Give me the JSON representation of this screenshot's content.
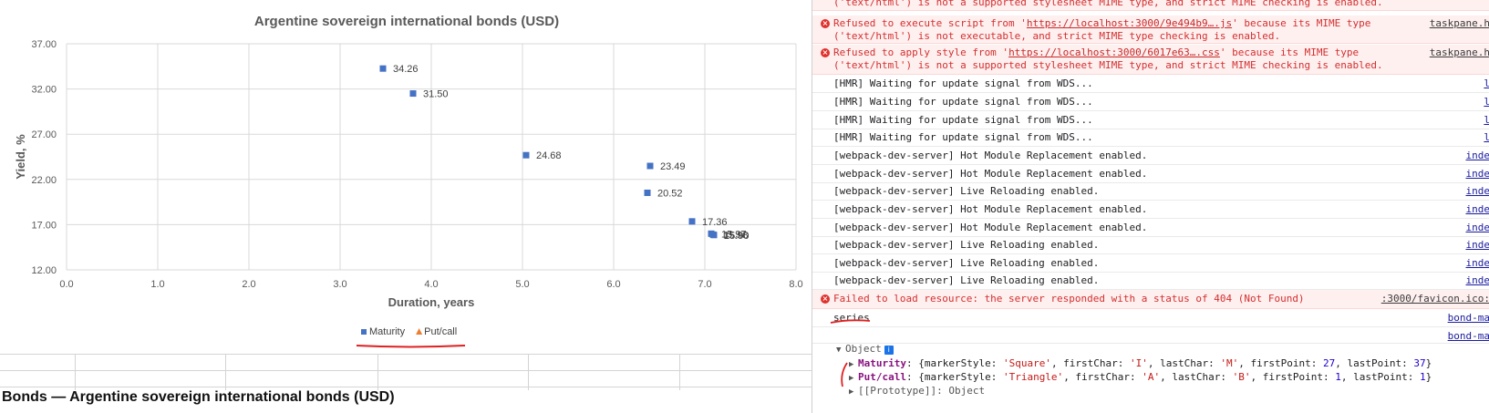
{
  "chart_data": {
    "type": "scatter",
    "title": "Argentine sovereign international bonds (USD)",
    "xlabel": "Duration, years",
    "ylabel": "Yield, %",
    "xlim": [
      0,
      8
    ],
    "ylim": [
      12,
      37
    ],
    "xticks": [
      "0.0",
      "1.0",
      "2.0",
      "3.0",
      "4.0",
      "5.0",
      "6.0",
      "7.0",
      "8.0"
    ],
    "yticks": [
      "12.00",
      "17.00",
      "22.00",
      "27.00",
      "32.00",
      "37.00"
    ],
    "x_tick_values": [
      0,
      1,
      2,
      3,
      4,
      5,
      6,
      7,
      8
    ],
    "y_tick_values": [
      12,
      17,
      22,
      27,
      32,
      37
    ],
    "grid": true,
    "legend_position": "bottom",
    "series": [
      {
        "name": "Maturity",
        "marker": "square",
        "color": "#4472c4",
        "points": [
          {
            "x": 3.47,
            "y": 34.26,
            "label": "34.26"
          },
          {
            "x": 3.8,
            "y": 31.5,
            "label": "31.50"
          },
          {
            "x": 5.04,
            "y": 24.68,
            "label": "24.68"
          },
          {
            "x": 6.4,
            "y": 23.49,
            "label": "23.49"
          },
          {
            "x": 6.37,
            "y": 20.52,
            "label": "20.52"
          },
          {
            "x": 6.86,
            "y": 17.36,
            "label": "17.36"
          },
          {
            "x": 7.07,
            "y": 16.0,
            "label": "15.97"
          },
          {
            "x": 7.09,
            "y": 15.9,
            "label": "15.98"
          },
          {
            "x": 7.1,
            "y": 15.85,
            "label": "15.90"
          }
        ]
      },
      {
        "name": "Put/call",
        "marker": "triangle",
        "color": "#ed7d31",
        "points": []
      }
    ]
  },
  "sheet": {
    "bottom_title": "Bonds — Argentine sovereign international bonds (USD)"
  },
  "console": {
    "messages": [
      {
        "type": "error",
        "text": "('text/html') is not a supported stylesheet MIME type, and strict MIME checking is enabled.",
        "source": ""
      },
      {
        "type": "error",
        "line1_pre": "Refused to execute script from '",
        "link": "https://localhost:3000/9e494b9….js",
        "line1_post": "' because its MIME type",
        "line2": "('text/html') is not executable, and strict MIME type checking is enabled.",
        "source": "taskpane.h"
      },
      {
        "type": "error",
        "line1_pre": "Refused to apply style from '",
        "link": "https://localhost:3000/6017e63….css",
        "line1_post": "' because its MIME type",
        "line2": "('text/html') is not a supported stylesheet MIME type, and strict MIME checking is enabled.",
        "source": "taskpane.h"
      },
      {
        "type": "log",
        "text": "[HMR] Waiting for update signal from WDS...",
        "source": "l"
      },
      {
        "type": "log",
        "text": "[HMR] Waiting for update signal from WDS...",
        "source": "l"
      },
      {
        "type": "log",
        "text": "[HMR] Waiting for update signal from WDS...",
        "source": "l"
      },
      {
        "type": "log",
        "text": "[HMR] Waiting for update signal from WDS...",
        "source": "l"
      },
      {
        "type": "log",
        "text": "[webpack-dev-server] Hot Module Replacement enabled.",
        "source": "inde"
      },
      {
        "type": "log",
        "text": "[webpack-dev-server] Hot Module Replacement enabled.",
        "source": "inde"
      },
      {
        "type": "log",
        "text": "[webpack-dev-server] Live Reloading enabled.",
        "source": "inde"
      },
      {
        "type": "log",
        "text": "[webpack-dev-server] Hot Module Replacement enabled.",
        "source": "inde"
      },
      {
        "type": "log",
        "text": "[webpack-dev-server] Hot Module Replacement enabled.",
        "source": "inde"
      },
      {
        "type": "log",
        "text": "[webpack-dev-server] Live Reloading enabled.",
        "source": "inde"
      },
      {
        "type": "log",
        "text": "[webpack-dev-server] Live Reloading enabled.",
        "source": "inde"
      },
      {
        "type": "log",
        "text": "[webpack-dev-server] Live Reloading enabled.",
        "source": "inde"
      },
      {
        "type": "error",
        "text": "Failed to load resource: the server responded with a status of 404 (Not Found)",
        "source": ":3000/favicon.ico:"
      },
      {
        "type": "log",
        "text": "series",
        "source": "bond-ma"
      },
      {
        "type": "log",
        "text": "",
        "source": "bond-ma"
      }
    ],
    "object_label": "Object",
    "info_badge": "i",
    "props": [
      {
        "key": "Maturity",
        "markerStyle": "'Square'",
        "firstChar": "'I'",
        "lastChar": "'M'",
        "firstPoint": "27",
        "lastPoint": "37"
      },
      {
        "key": "Put/call",
        "markerStyle": "'Triangle'",
        "firstChar": "'A'",
        "lastChar": "'B'",
        "firstPoint": "1",
        "lastPoint": "1"
      }
    ],
    "prototype": "[[Prototype]]: Object"
  }
}
